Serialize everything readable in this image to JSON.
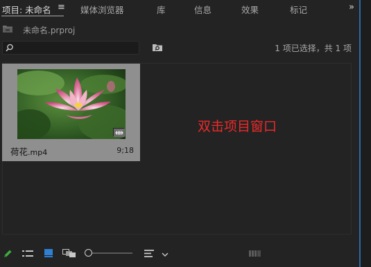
{
  "tabs": {
    "project_label": "项目: 未命名",
    "menu_glyph": "≡",
    "items": [
      "媒体浏览器",
      "库",
      "信息",
      "效果",
      "标记"
    ],
    "overflow_glyph": "»"
  },
  "project": {
    "file_name": "未命名.prproj"
  },
  "search": {
    "value": "",
    "placeholder": ""
  },
  "selection_status": "1 项已选择，共 1 项",
  "clip": {
    "name": "荷花",
    "extension": ".mp4",
    "duration": "9;18"
  },
  "annotation": "双击项目窗口",
  "icons": {
    "pencil": "pencil-icon",
    "list_view": "list-view-icon",
    "icon_view": "icon-view-icon",
    "freeform_view": "freeform-view-icon",
    "sort": "sort-icon",
    "automate": "automate-to-sequence-icon"
  },
  "colors": {
    "panel_bg": "#232323",
    "accent_border": "#2d6ba8",
    "annotation": "#ee2a2a",
    "thumb_card": "#8f8f8f",
    "pencil_green": "#3fae3f",
    "icon_view_blue": "#2f7fd3"
  }
}
